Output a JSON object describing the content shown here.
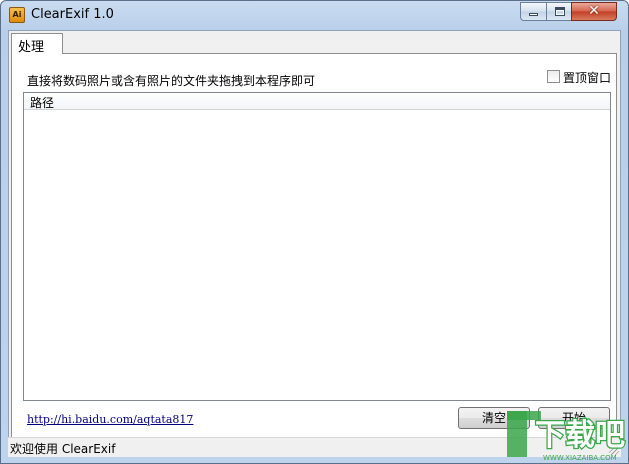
{
  "window": {
    "title": "ClearExif 1.0",
    "app_icon_text": "Ai"
  },
  "tabs": [
    {
      "label": "处理",
      "active": true
    }
  ],
  "panel": {
    "instruction": "直接将数码照片或含有照片的文件夹拖拽到本程序即可",
    "topmost_checkbox": {
      "label": "置顶窗口",
      "checked": false
    },
    "file_list": {
      "columns": [
        "路径"
      ],
      "rows": []
    },
    "link": "http://hi.baidu.com/aqtata817",
    "buttons": {
      "clear": "清空",
      "start": "开始"
    }
  },
  "statusbar": {
    "text": "欢迎使用 ClearExif"
  },
  "watermark": {
    "text": "下载吧",
    "subtext": "WWW.XIAZAIBA.COM",
    "color": "#3aa64a"
  },
  "colors": {
    "close_button": "#c23f23",
    "link": "#000080"
  },
  "icons": {
    "minimize": "minimize-icon",
    "maximize": "maximize-icon",
    "close": "close-icon"
  }
}
